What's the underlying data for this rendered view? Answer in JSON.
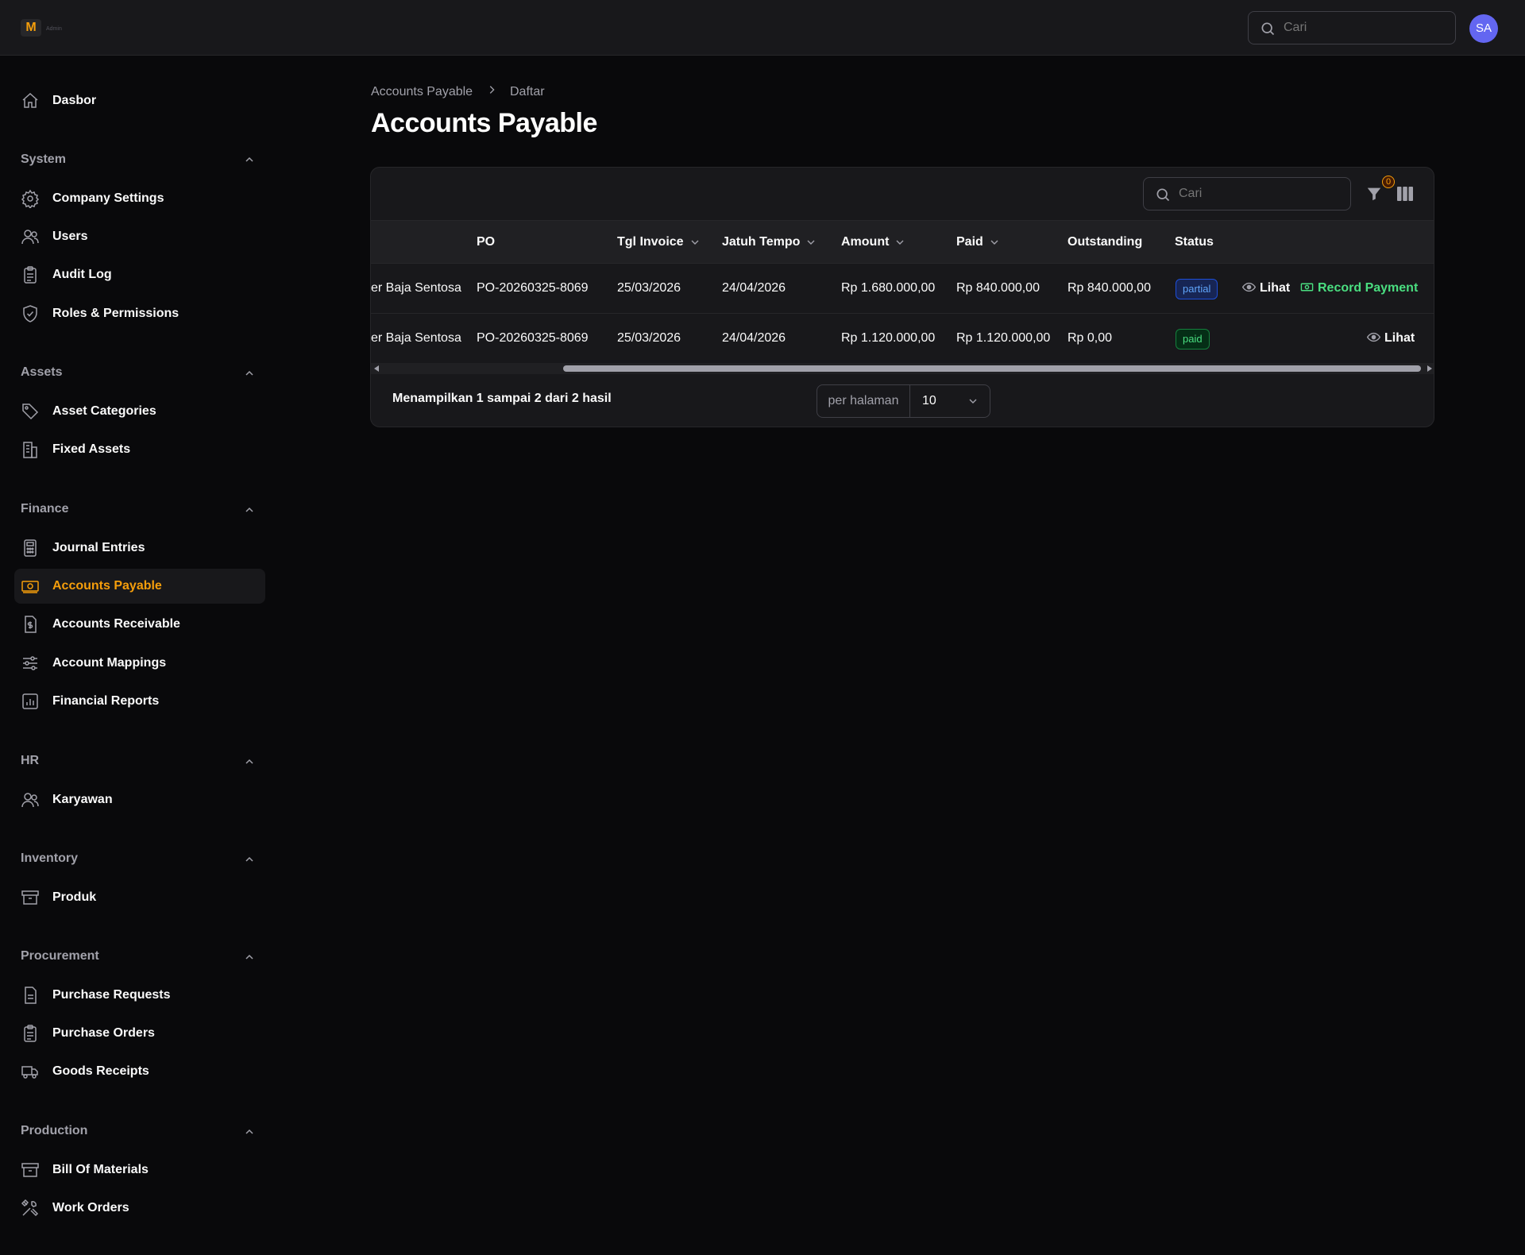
{
  "app": {
    "logo_letter": "M",
    "logo_sub": "Admin"
  },
  "header": {
    "search_placeholder": "Cari",
    "avatar_initials": "SA"
  },
  "sidebar": {
    "top_item": "Dasbor",
    "groups": [
      {
        "title": "System",
        "items": [
          "Company Settings",
          "Users",
          "Audit Log",
          "Roles & Permissions"
        ]
      },
      {
        "title": "Assets",
        "items": [
          "Asset Categories",
          "Fixed Assets"
        ]
      },
      {
        "title": "Finance",
        "items": [
          "Journal Entries",
          "Accounts Payable",
          "Accounts Receivable",
          "Account Mappings",
          "Financial Reports"
        ]
      },
      {
        "title": "HR",
        "items": [
          "Karyawan"
        ]
      },
      {
        "title": "Inventory",
        "items": [
          "Produk"
        ]
      },
      {
        "title": "Procurement",
        "items": [
          "Purchase Requests",
          "Purchase Orders",
          "Goods Receipts"
        ]
      },
      {
        "title": "Production",
        "items": [
          "Bill Of Materials",
          "Work Orders"
        ]
      }
    ],
    "active_item": "Accounts Payable"
  },
  "breadcrumb": {
    "parent": "Accounts Payable",
    "current": "Daftar"
  },
  "page_title": "Accounts Payable",
  "table": {
    "search_placeholder": "Cari",
    "filter_count": "0",
    "columns": {
      "po": "PO",
      "invoice_date": "Tgl Invoice",
      "due_date": "Jatuh Tempo",
      "amount": "Amount",
      "paid": "Paid",
      "outstanding": "Outstanding",
      "status": "Status"
    },
    "rows": [
      {
        "supplier": "er Baja Sentosa",
        "po": "PO-20260325-8069",
        "invoice_date": "25/03/2026",
        "due_date": "24/04/2026",
        "amount": "Rp 1.680.000,00",
        "paid": "Rp 840.000,00",
        "outstanding": "Rp 840.000,00",
        "status": "partial",
        "view": "Lihat",
        "pay": "Record Payment"
      },
      {
        "supplier": "er Baja Sentosa",
        "po": "PO-20260325-8069",
        "invoice_date": "25/03/2026",
        "due_date": "24/04/2026",
        "amount": "Rp 1.120.000,00",
        "paid": "Rp 1.120.000,00",
        "outstanding": "Rp 0,00",
        "status": "paid",
        "view": "Lihat"
      }
    ],
    "footer_text": "Menampilkan 1 sampai 2 dari 2 hasil",
    "per_page_label": "per halaman",
    "per_page_value": "10"
  },
  "colors": {
    "accent": "#f59e0b",
    "partial": "#60a5fa",
    "paid": "#4ade80",
    "avatar": "#6366f1"
  }
}
